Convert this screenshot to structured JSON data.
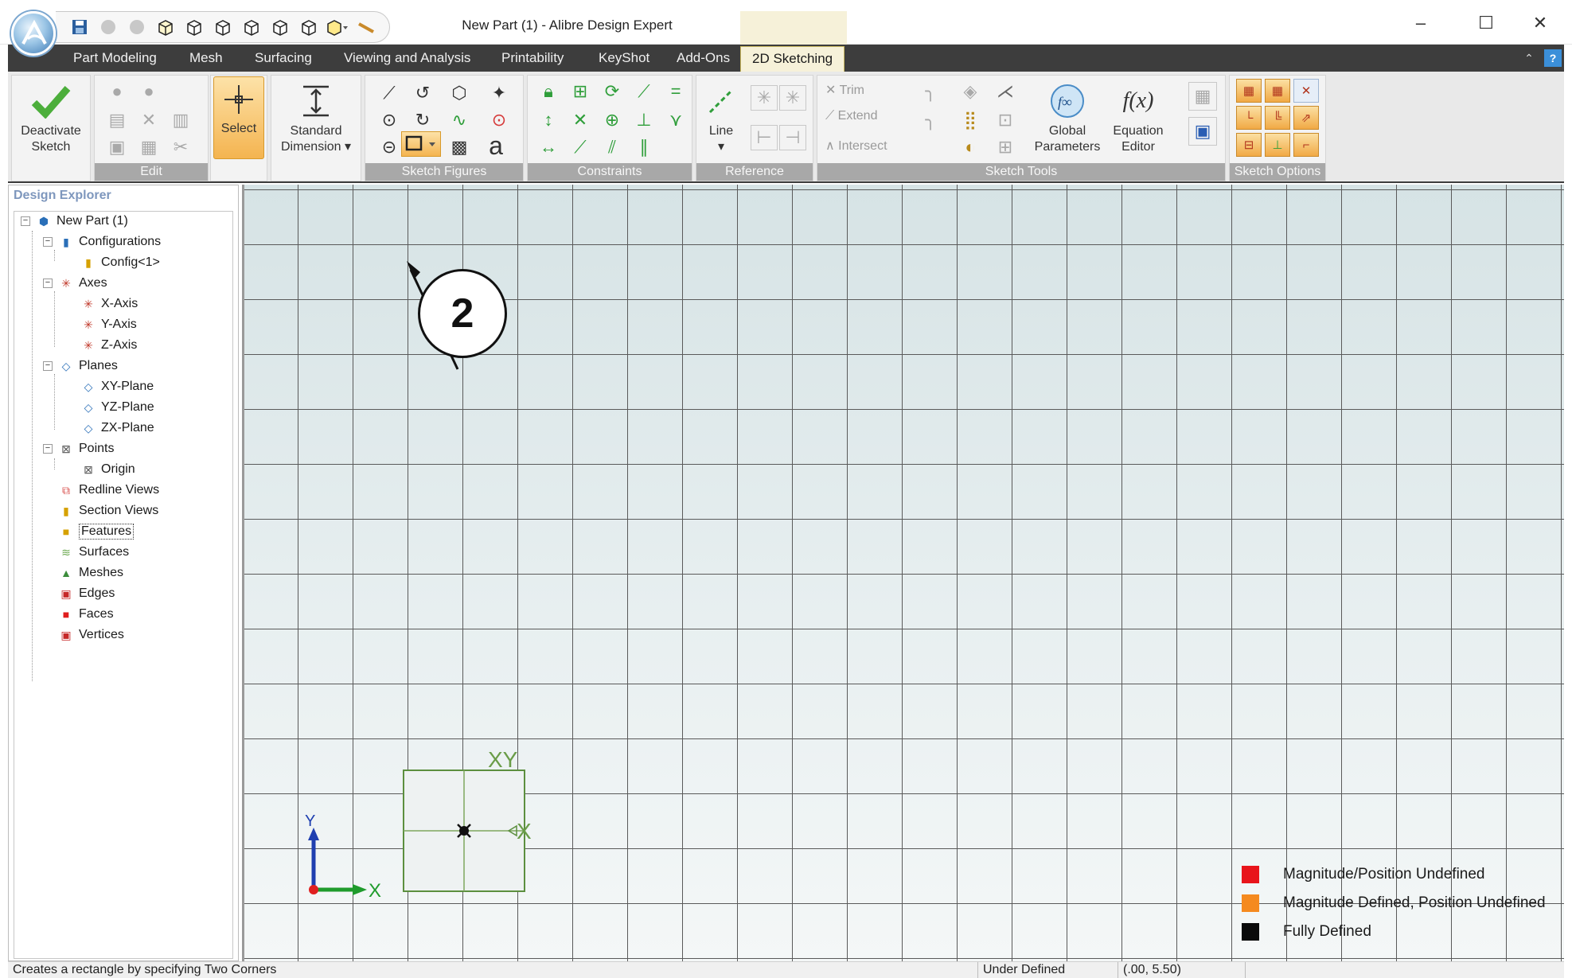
{
  "window": {
    "title": "New Part (1) - Alibre Design Expert",
    "minimize": "–",
    "maximize": "☐",
    "close": "✕"
  },
  "tabs": [
    {
      "label": "Part Modeling"
    },
    {
      "label": "Mesh"
    },
    {
      "label": "Surfacing"
    },
    {
      "label": "Viewing and Analysis"
    },
    {
      "label": "Printability"
    },
    {
      "label": "KeyShot"
    },
    {
      "label": "Add-Ons"
    },
    {
      "label": "2D Sketching",
      "active": true
    }
  ],
  "ribbon": {
    "deactivate": {
      "line1": "Deactivate",
      "line2": "Sketch"
    },
    "edit_label": "Edit",
    "select_label": "Select",
    "standard_dimension": {
      "line1": "Standard",
      "line2": "Dimension ▾"
    },
    "sketch_figures_label": "Sketch Figures",
    "text_tool_glyph": "a",
    "constraints_label": "Constraints",
    "reference": {
      "line_label": "Line",
      "group_label": "Reference"
    },
    "sketch_tools": {
      "trim": "Trim",
      "extend": "Extend",
      "intersect": "Intersect",
      "global_parameters": {
        "line1": "Global",
        "line2": "Parameters"
      },
      "equation_editor": {
        "line1": "Equation",
        "line2": "Editor"
      },
      "equation_glyph": "f(x)",
      "group_label": "Sketch Tools"
    },
    "sketch_options_label": "Sketch Options"
  },
  "explorer": {
    "title": "Design Explorer",
    "nodes": [
      {
        "label": "New Part (1)",
        "icon": "part-icon"
      },
      {
        "label": "Configurations",
        "icon": "configurations-icon"
      },
      {
        "label": "Config<1>",
        "icon": "config-icon"
      },
      {
        "label": "Axes",
        "icon": "axes-icon"
      },
      {
        "label": "X-Axis",
        "icon": "axis-icon"
      },
      {
        "label": "Y-Axis",
        "icon": "axis-icon"
      },
      {
        "label": "Z-Axis",
        "icon": "axis-icon"
      },
      {
        "label": "Planes",
        "icon": "planes-icon"
      },
      {
        "label": "XY-Plane",
        "icon": "plane-icon"
      },
      {
        "label": "YZ-Plane",
        "icon": "plane-icon"
      },
      {
        "label": "ZX-Plane",
        "icon": "plane-icon"
      },
      {
        "label": "Points",
        "icon": "points-icon"
      },
      {
        "label": "Origin",
        "icon": "origin-icon"
      },
      {
        "label": "Redline Views",
        "icon": "redline-icon"
      },
      {
        "label": "Section Views",
        "icon": "section-icon"
      },
      {
        "label": "Features",
        "icon": "features-icon"
      },
      {
        "label": "Surfaces",
        "icon": "surfaces-icon"
      },
      {
        "label": "Meshes",
        "icon": "meshes-icon"
      },
      {
        "label": "Edges",
        "icon": "edges-icon"
      },
      {
        "label": "Faces",
        "icon": "faces-icon"
      },
      {
        "label": "Vertices",
        "icon": "vertices-icon"
      }
    ]
  },
  "viewport": {
    "callout_number": "2",
    "axis_labels": {
      "x": "X",
      "y": "Y",
      "xy": "XY"
    },
    "legend": [
      {
        "label": "Magnitude/Position Undefined",
        "color": "#e8141b"
      },
      {
        "label": "Magnitude Defined, Position Undefined",
        "color": "#f58a1f"
      },
      {
        "label": "Fully Defined",
        "color": "#0a0a0a"
      }
    ]
  },
  "status": {
    "hint": "Creates a rectangle by specifying Two Corners",
    "state": "Under Defined",
    "coords": "(.00, 5.50)"
  },
  "colors": {
    "accent": "#f4b450",
    "sketch_green": "#2f9e3a",
    "grid_line": "#5a5a5a"
  }
}
